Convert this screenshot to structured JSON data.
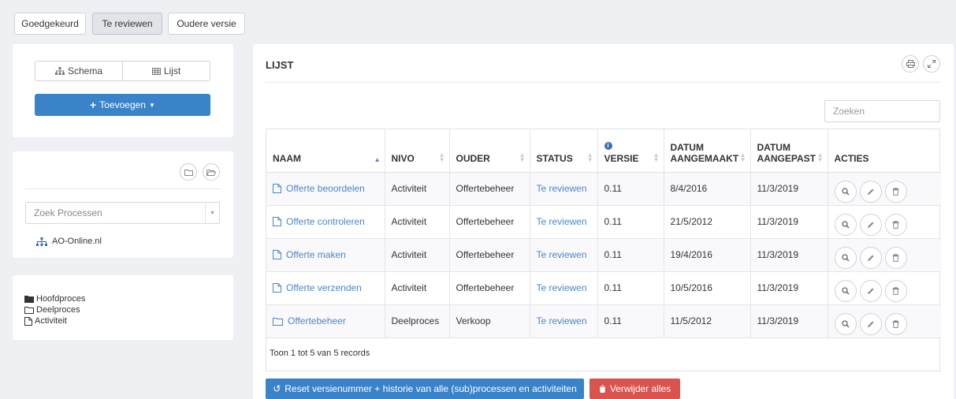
{
  "top_tabs": [
    {
      "label": "Goedgekeurd"
    },
    {
      "label": "Te reviewen"
    },
    {
      "label": "Oudere versie"
    }
  ],
  "sidebar": {
    "view_toggle": {
      "schema_label": "Schema",
      "lijst_label": "Lijst"
    },
    "add_label": "Toevoegen",
    "search_placeholder": "Zoek Processen",
    "tree_root": "AO-Online.nl",
    "legend": [
      {
        "label": "Hoofdproces",
        "icon": "folder-filled-icon"
      },
      {
        "label": "Deelproces",
        "icon": "folder-outline-icon"
      },
      {
        "label": "Activiteit",
        "icon": "file-icon"
      }
    ]
  },
  "main": {
    "title": "LIJST",
    "search_placeholder": "Zoeken",
    "columns": [
      "NAAM",
      "NIVO",
      "OUDER",
      "STATUS",
      "VERSIE",
      "DATUM AANGEMAAKT",
      "DATUM AANGEPAST",
      "ACTIES"
    ],
    "rows": [
      {
        "naam": "Offerte beoordelen",
        "nivo": "Activiteit",
        "ouder": "Offertebeheer",
        "status": "Te reviewen",
        "versie": "0.11",
        "aangemaakt": "8/4/2016",
        "aangepast": "11/3/2019",
        "icon": "file-icon"
      },
      {
        "naam": "Offerte controleren",
        "nivo": "Activiteit",
        "ouder": "Offertebeheer",
        "status": "Te reviewen",
        "versie": "0.11",
        "aangemaakt": "21/5/2012",
        "aangepast": "11/3/2019",
        "icon": "file-icon"
      },
      {
        "naam": "Offerte maken",
        "nivo": "Activiteit",
        "ouder": "Offertebeheer",
        "status": "Te reviewen",
        "versie": "0.11",
        "aangemaakt": "19/4/2016",
        "aangepast": "11/3/2019",
        "icon": "file-icon"
      },
      {
        "naam": "Offerte verzenden",
        "nivo": "Activiteit",
        "ouder": "Offertebeheer",
        "status": "Te reviewen",
        "versie": "0.11",
        "aangemaakt": "10/5/2016",
        "aangepast": "11/3/2019",
        "icon": "file-icon"
      },
      {
        "naam": "Offertebeheer",
        "nivo": "Deelproces",
        "ouder": "Verkoop",
        "status": "Te reviewen",
        "versie": "0.11",
        "aangemaakt": "11/5/2012",
        "aangepast": "11/3/2019",
        "icon": "folder-outline-icon"
      }
    ],
    "footer": "Toon 1 tot 5 van 5 records",
    "reset_label": "Reset versienummer + historie van alle (sub)processen en activiteiten",
    "delete_all_label": "Verwijder alles"
  },
  "colors": {
    "primary": "#3a83c9",
    "danger": "#d9534f",
    "link": "#4a86c6",
    "background": "#eef0f4"
  }
}
